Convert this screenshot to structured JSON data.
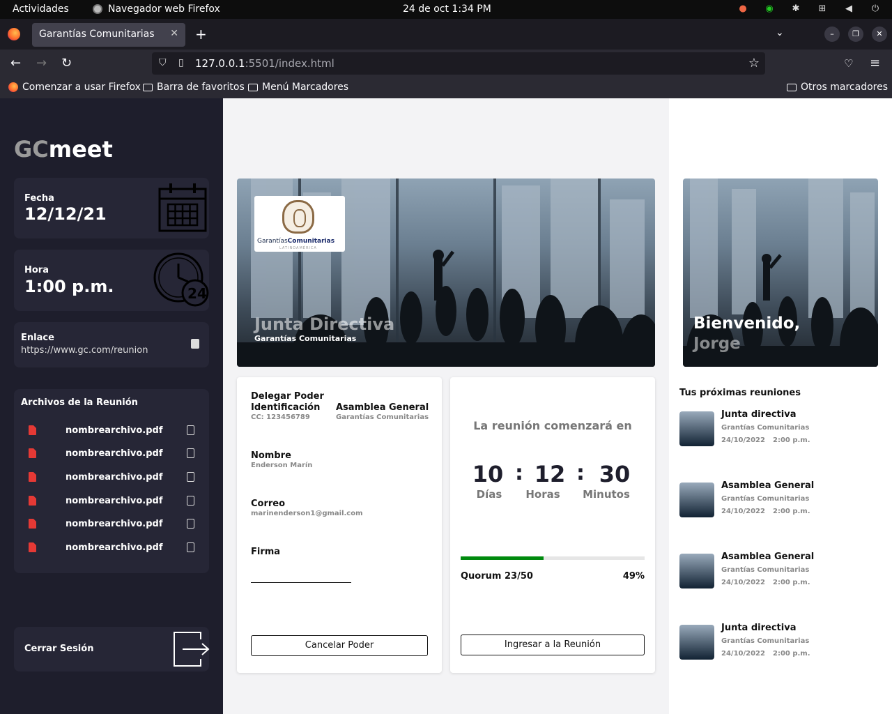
{
  "os": {
    "activities": "Actividades",
    "app_name": "Navegador web Firefox",
    "clock": "24 de oct   1:34 PM"
  },
  "browser": {
    "tab_title": "Garantías Comunitarias",
    "url_host": "127.0.0.1",
    "url_rest": ":5501/index.html",
    "bookmarks": [
      "Comenzar a usar Firefox",
      "Barra de favoritos",
      "Menú Marcadores"
    ],
    "other_bookmarks": "Otros marcadores"
  },
  "sidebar": {
    "brand_gc": "GC",
    "brand_meet": "meet",
    "date_label": "Fecha",
    "date_value": "12/12/21",
    "time_label": "Hora",
    "time_value": "1:00 p.m.",
    "link_label": "Enlace",
    "link_value": "https://www.gc.com/reunion",
    "files_title": "Archivos de la Reunión",
    "files": [
      "nombrearchivo.pdf",
      "nombrearchivo.pdf",
      "nombrearchivo.pdf",
      "nombrearchivo.pdf",
      "nombrearchivo.pdf",
      "nombrearchivo.pdf"
    ],
    "logout": "Cerrar Sesión",
    "clock_badge": "24"
  },
  "hero": {
    "logo_text_a": "Garantías",
    "logo_text_b": "Comunitarias",
    "logo_sub": "LATINOAMÉRICA",
    "title": "Junta Directiva",
    "subtitle": "Garantías Comunitarias"
  },
  "delegate": {
    "heading": "Delegar Poder",
    "id_label": "Identificación",
    "id_value": "CC: 123456789",
    "assembly_label": "Asamblea General",
    "assembly_value": "Garantías Comunitarias",
    "name_label": "Nombre",
    "name_value": "Enderson Marín",
    "email_label": "Correo",
    "email_value": "marinenderson1@gmail.com",
    "signature_label": "Firma",
    "cancel_button": "Cancelar Poder"
  },
  "countdown": {
    "title": "La reunión comenzará en",
    "days": "10",
    "hours": "12",
    "minutes": "30",
    "days_label": "Días",
    "hours_label": "Horas",
    "minutes_label": "Minutos",
    "separator": ":",
    "quorum": "Quorum 23/50",
    "quorum_percent": "49%",
    "quorum_fraction": 0.45,
    "join_button": "Ingresar a la Reunión",
    "progress_color": "#008a0e"
  },
  "welcome": {
    "line1": "Bienvenido,",
    "line2": "Jorge"
  },
  "upcoming": {
    "title": "Tus próximas reuniones",
    "items": [
      {
        "title": "Junta directiva",
        "org": "Grantías Comunitarias",
        "date": "24/10/2022",
        "time": "2:00 p.m."
      },
      {
        "title": "Asamblea General",
        "org": "Grantías Comunitarias",
        "date": "24/10/2022",
        "time": "2:00 p.m."
      },
      {
        "title": "Asamblea General",
        "org": "Grantías Comunitarias",
        "date": "24/10/2022",
        "time": "2:00 p.m."
      },
      {
        "title": "Junta directiva",
        "org": "Grantías Comunitarias",
        "date": "24/10/2022",
        "time": "2:00 p.m."
      }
    ]
  }
}
